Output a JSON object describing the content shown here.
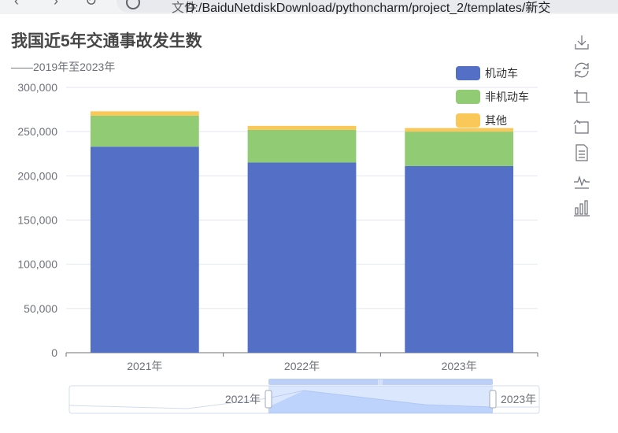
{
  "browser": {
    "file_label": "文件",
    "url": "D:/BaiduNetdiskDownload/pythoncharm/project_2/templates/新交"
  },
  "title": "我国近5年交通事故发生数",
  "subtitle": "——2019年至2023年",
  "toolbox": [
    "download-icon",
    "refresh-icon",
    "zoom-icon",
    "zoom-reset-icon",
    "data-view-icon",
    "line-chart-icon",
    "bar-chart-icon"
  ],
  "chart_data": {
    "type": "bar",
    "stacked": true,
    "categories": [
      "2021年",
      "2022年",
      "2023年"
    ],
    "series": [
      {
        "name": "机动车",
        "color": "#5470c6",
        "values": [
          233000,
          215000,
          211000
        ]
      },
      {
        "name": "非机动车",
        "color": "#91cc75",
        "values": [
          35000,
          37000,
          39000
        ]
      },
      {
        "name": "其他",
        "color": "#fac858",
        "values": [
          5000,
          4500,
          4000
        ]
      }
    ],
    "yticks": [
      "0",
      "50,000",
      "100,000",
      "150,000",
      "200,000",
      "250,000",
      "300,000"
    ],
    "ylim": [
      0,
      300000
    ],
    "grid": true,
    "legend_position": "top-right",
    "datazoom": {
      "start_label": "2021年",
      "end_label": "2023年"
    }
  }
}
